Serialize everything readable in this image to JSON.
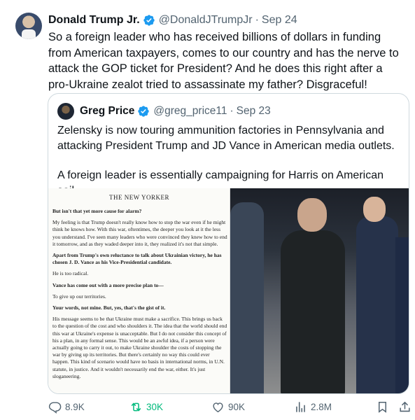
{
  "tweet": {
    "author_name": "Donald Trump Jr.",
    "author_handle": "@DonaldJTrumpJr",
    "separator": "·",
    "date": "Sep 24",
    "text": "So a foreign leader who has received billions of dollars in funding from American taxpayers, comes to our country and has the nerve to attack the GOP ticket for President? And he does this right after a pro-Ukraine zealot tried to assassinate my father? Disgraceful!"
  },
  "quote": {
    "author_name": "Greg Price",
    "author_handle": "@greg_price11",
    "separator": "·",
    "date": "Sep 23",
    "paragraphs": [
      "Zelensky is now touring ammunition factories in Pennsylvania and attacking President Trump and JD Vance in American media outlets.",
      "A foreign leader is essentially campaigning for Harris on American soil."
    ],
    "article": {
      "logo": "THE NEW YORKER",
      "lines": [
        {
          "bold": true,
          "text": "But isn't that yet more cause for alarm?"
        },
        {
          "bold": false,
          "text": "My feeling is that Trump doesn't really know how to stop the war even if he might think he knows how. With this war, oftentimes, the deeper you look at it the less you understand. I've seen many leaders who were convinced they knew how to end it tomorrow, and as they waded deeper into it, they realized it's not that simple."
        },
        {
          "bold": true,
          "text": "Apart from Trump's own reluctance to talk about Ukrainian victory, he has chosen J. D. Vance as his Vice-Presidential candidate."
        },
        {
          "bold": false,
          "text": "He is too radical."
        },
        {
          "bold": true,
          "text": "Vance has come out with a more precise plan to—"
        },
        {
          "bold": false,
          "text": "To give up our territories."
        },
        {
          "bold": true,
          "text": "Your words, not mine. But, yes, that's the gist of it."
        },
        {
          "bold": false,
          "text": "His message seems to be that Ukraine must make a sacrifice. This brings us back to the question of the cost and who shoulders it. The idea that the world should end this war at Ukraine's expense is unacceptable. But I do not consider this concept of his a plan, in any formal sense. This would be an awful idea, if a person were actually going to carry it out, to make Ukraine shoulder the costs of stopping the war by giving up its territories. But there's certainly no way this could ever happen. This kind of scenario would have no basis in international norms, in U.N. statute, in justice. And it wouldn't necessarily end the war, either. It's just sloganeering."
        }
      ]
    }
  },
  "actions": {
    "replies": "8.9K",
    "reposts": "30K",
    "likes": "90K",
    "views": "2.8M"
  },
  "colors": {
    "verified": "#1d9bf0",
    "retweet": "#00ba7c",
    "muted": "#536471"
  }
}
